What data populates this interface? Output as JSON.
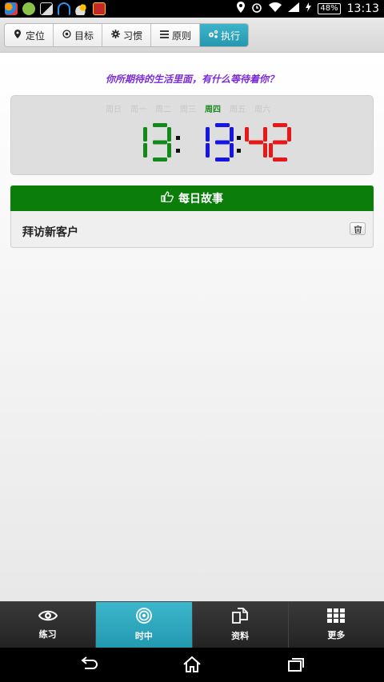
{
  "status_bar": {
    "time": "13:13",
    "battery": "48%",
    "icons": [
      "app-icon",
      "wechat-icon",
      "image-icon",
      "headset-icon",
      "weather-icon",
      "app-badge-icon",
      "location-icon",
      "alarm-icon",
      "wifi-icon",
      "signal-icon",
      "charging-icon"
    ]
  },
  "top_tabs": [
    {
      "label": "定位",
      "icon": "map-marker-icon"
    },
    {
      "label": "目标",
      "icon": "target-icon"
    },
    {
      "label": "习惯",
      "icon": "gear-icon"
    },
    {
      "label": "原则",
      "icon": "list-icon"
    },
    {
      "label": "执行",
      "icon": "cogs-icon",
      "active": true
    }
  ],
  "quote": "你所期待的生活里面，有什么等待着你？",
  "clock": {
    "weekdays": [
      "周日",
      "周一",
      "周二",
      "周三",
      "周四",
      "周五",
      "周六"
    ],
    "today_index": 4,
    "hours": "13",
    "minutes": "13",
    "seconds": "42",
    "colors": {
      "hours": "#118a1a",
      "minutes": "#1515e6",
      "seconds": "#e81818",
      "colon": "#111111"
    }
  },
  "story": {
    "header": "每日故事",
    "header_icon": "hand-pointer-icon",
    "item": "拜访新客户",
    "delete_icon": "trash-icon"
  },
  "bottom_tabs": [
    {
      "label": "练习",
      "icon": "eye-icon"
    },
    {
      "label": "时中",
      "icon": "target-rings-icon",
      "active": true
    },
    {
      "label": "资料",
      "icon": "copy-icon"
    },
    {
      "label": "更多",
      "icon": "grid-icon"
    }
  ],
  "colors": {
    "accent": "#2aa3ba",
    "story_green": "#0b7d0b",
    "quote_purple": "#7a2bd6"
  }
}
